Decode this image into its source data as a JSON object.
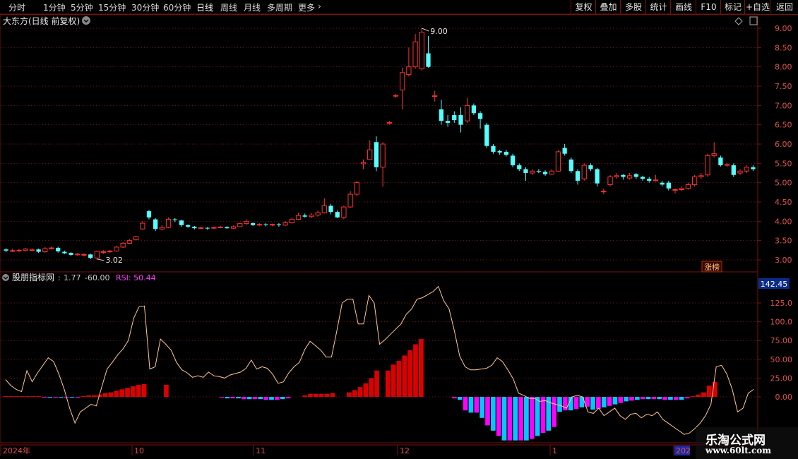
{
  "toolbar": {
    "periods": [
      {
        "label": "分时",
        "active": false
      },
      {
        "label": "1分钟",
        "active": false
      },
      {
        "label": "5分钟",
        "active": false
      },
      {
        "label": "15分钟",
        "active": false
      },
      {
        "label": "30分钟",
        "active": false
      },
      {
        "label": "60分钟",
        "active": false
      },
      {
        "label": "日线",
        "active": true
      },
      {
        "label": "周线",
        "active": false
      },
      {
        "label": "月线",
        "active": false
      },
      {
        "label": "多周期",
        "active": false
      },
      {
        "label": "更多",
        "active": false
      }
    ],
    "tools": [
      "复权",
      "叠加",
      "多股",
      "统计",
      "画线",
      "F10",
      "标记",
      "+自选",
      "返回"
    ]
  },
  "price_pane": {
    "title": "大东方(日线 前复权)",
    "high_label": "9.00",
    "low_label": "3.02",
    "badge": "涨榜",
    "axis_ticks": [
      "9.00",
      "8.50",
      "8.00",
      "7.50",
      "7.00",
      "6.50",
      "6.00",
      "5.50",
      "5.00",
      "4.50",
      "4.00",
      "3.50",
      "3.00"
    ]
  },
  "indicator_pane": {
    "name": "股朋指标网",
    "v1": "1.77",
    "v2": "-60.00",
    "rsi_label": "RSI: 50.44",
    "axis_ticks": [
      "125.0",
      "100.0",
      "75.00",
      "50.00",
      "25.00",
      "0.00"
    ],
    "current_value": "142.45"
  },
  "date_axis": [
    "2024年",
    "10",
    "11",
    "12",
    "1",
    "202"
  ],
  "watermark": {
    "title": "乐淘公式网",
    "url": "www.60lt.com"
  },
  "colors": {
    "up": "#ff3232",
    "down": "#54ffff",
    "bar_red": "#dd0000",
    "bar_cyan": "#00c8ff",
    "bar_magenta": "#ff00ff",
    "rsi_line": "#ffc896",
    "grid": "#7a1010"
  },
  "chart_data": [
    {
      "type": "candlestick",
      "title": "大东方(日线 前复权)",
      "ylim": [
        3.0,
        9.0
      ],
      "y_ticks": [
        9.0,
        8.5,
        8.0,
        7.5,
        7.0,
        6.5,
        6.0,
        5.5,
        5.0,
        4.5,
        4.0,
        3.5,
        3.0
      ],
      "annotations": {
        "high": 9.0,
        "low": 3.02
      },
      "candles": [
        [
          3.27,
          3.24,
          3.3,
          3.2
        ],
        [
          3.24,
          3.24,
          3.29,
          3.2
        ],
        [
          3.24,
          3.25,
          3.28,
          3.21
        ],
        [
          3.25,
          3.28,
          3.31,
          3.22
        ],
        [
          3.26,
          3.26,
          3.3,
          3.22
        ],
        [
          3.27,
          3.21,
          3.29,
          3.18
        ],
        [
          3.21,
          3.29,
          3.33,
          3.18
        ],
        [
          3.29,
          3.31,
          3.35,
          3.27
        ],
        [
          3.31,
          3.22,
          3.34,
          3.19
        ],
        [
          3.21,
          3.17,
          3.24,
          3.15
        ],
        [
          3.18,
          3.13,
          3.2,
          3.1
        ],
        [
          3.13,
          3.15,
          3.18,
          3.11
        ],
        [
          3.14,
          3.14,
          3.17,
          3.09
        ],
        [
          3.14,
          3.05,
          3.16,
          3.02
        ],
        [
          3.05,
          3.22,
          3.24,
          3.02
        ],
        [
          3.2,
          3.21,
          3.25,
          3.16
        ],
        [
          3.21,
          3.23,
          3.26,
          3.18
        ],
        [
          3.23,
          3.33,
          3.36,
          3.21
        ],
        [
          3.33,
          3.43,
          3.46,
          3.31
        ],
        [
          3.43,
          3.5,
          3.54,
          3.41
        ],
        [
          3.52,
          3.6,
          3.63,
          3.5
        ],
        [
          3.8,
          3.95,
          4.0,
          3.78
        ],
        [
          4.26,
          4.1,
          4.3,
          4.05
        ],
        [
          4.05,
          3.8,
          4.08,
          3.75
        ],
        [
          3.8,
          3.84,
          3.9,
          3.76
        ],
        [
          3.84,
          4.05,
          4.1,
          3.82
        ],
        [
          4.05,
          4.03,
          4.08,
          3.98
        ],
        [
          4.02,
          3.9,
          4.04,
          3.86
        ],
        [
          3.9,
          3.86,
          3.92,
          3.83
        ],
        [
          3.86,
          3.82,
          3.88,
          3.79
        ],
        [
          3.82,
          3.83,
          3.86,
          3.8
        ],
        [
          3.83,
          3.82,
          3.85,
          3.78
        ],
        [
          3.82,
          3.84,
          3.86,
          3.8
        ],
        [
          3.84,
          3.85,
          3.88,
          3.82
        ],
        [
          3.85,
          3.82,
          3.87,
          3.8
        ],
        [
          3.82,
          3.86,
          3.89,
          3.8
        ],
        [
          3.86,
          3.94,
          3.96,
          3.85
        ],
        [
          3.94,
          4.0,
          4.05,
          3.9
        ],
        [
          3.95,
          3.9,
          3.97,
          3.88
        ],
        [
          3.9,
          3.92,
          3.95,
          3.88
        ],
        [
          3.92,
          3.9,
          3.95,
          3.87
        ],
        [
          3.9,
          3.92,
          3.94,
          3.87
        ],
        [
          3.92,
          3.9,
          3.95,
          3.86
        ],
        [
          3.9,
          3.96,
          4.0,
          3.88
        ],
        [
          3.96,
          4.05,
          4.1,
          3.94
        ],
        [
          4.05,
          4.15,
          4.22,
          4.03
        ],
        [
          4.15,
          4.12,
          4.2,
          4.1
        ],
        [
          4.12,
          4.16,
          4.22,
          4.08
        ],
        [
          4.16,
          4.22,
          4.28,
          4.12
        ],
        [
          4.22,
          4.4,
          4.6,
          4.2
        ],
        [
          4.4,
          4.24,
          4.45,
          4.18
        ],
        [
          4.24,
          4.1,
          4.28,
          4.08
        ],
        [
          4.1,
          4.37,
          4.4,
          4.05
        ],
        [
          4.37,
          4.7,
          4.78,
          4.35
        ],
        [
          4.7,
          5.0,
          5.05,
          4.65
        ],
        [
          5.49,
          5.52,
          5.6,
          5.35
        ],
        [
          5.6,
          5.85,
          6.1,
          5.75
        ],
        [
          6.05,
          5.4,
          6.2,
          5.3
        ],
        [
          5.4,
          6.0,
          6.05,
          4.9
        ],
        [
          6.54,
          6.56,
          6.6,
          6.5
        ],
        [
          7.24,
          7.26,
          7.3,
          7.2
        ],
        [
          7.4,
          7.85,
          7.98,
          6.9
        ],
        [
          7.8,
          8.0,
          8.5,
          7.75
        ],
        [
          8.0,
          8.65,
          8.85,
          7.95
        ],
        [
          7.95,
          8.9,
          9.0,
          7.9
        ],
        [
          8.35,
          8.0,
          8.8,
          7.98
        ],
        [
          7.25,
          7.25,
          7.38,
          7.1
        ],
        [
          6.9,
          6.6,
          7.15,
          6.5
        ],
        [
          6.6,
          6.55,
          6.75,
          6.45
        ],
        [
          6.75,
          6.62,
          6.85,
          6.55
        ],
        [
          6.75,
          6.5,
          6.95,
          6.3
        ],
        [
          6.6,
          7.0,
          7.2,
          6.55
        ],
        [
          7.0,
          6.8,
          7.05,
          6.75
        ],
        [
          6.8,
          6.65,
          6.85,
          6.4
        ],
        [
          6.5,
          5.95,
          6.55,
          5.9
        ],
        [
          5.95,
          5.8,
          6.0,
          5.75
        ],
        [
          5.82,
          5.78,
          5.85,
          5.72
        ],
        [
          5.8,
          5.72,
          5.85,
          5.68
        ],
        [
          5.7,
          5.45,
          5.75,
          5.4
        ],
        [
          5.45,
          5.35,
          5.5,
          5.3
        ],
        [
          5.35,
          5.25,
          5.4,
          5.05
        ],
        [
          5.25,
          5.3,
          5.35,
          5.2
        ],
        [
          5.3,
          5.28,
          5.35,
          5.25
        ],
        [
          5.28,
          5.22,
          5.32,
          5.18
        ],
        [
          5.22,
          5.3,
          5.35,
          5.2
        ],
        [
          5.3,
          5.8,
          5.85,
          5.28
        ],
        [
          5.9,
          5.75,
          6.0,
          5.7
        ],
        [
          5.6,
          5.3,
          5.65,
          5.25
        ],
        [
          5.3,
          5.05,
          5.35,
          4.95
        ],
        [
          5.1,
          5.45,
          5.5,
          5.05
        ],
        [
          5.45,
          5.35,
          5.5,
          5.3
        ],
        [
          5.35,
          4.98,
          5.38,
          4.9
        ],
        [
          4.78,
          4.78,
          4.85,
          4.7
        ],
        [
          4.95,
          5.15,
          5.2,
          4.9
        ],
        [
          5.15,
          5.18,
          5.25,
          5.1
        ],
        [
          5.2,
          5.15,
          5.22,
          5.08
        ],
        [
          5.12,
          5.18,
          5.25,
          5.08
        ],
        [
          5.22,
          5.15,
          5.25,
          5.1
        ],
        [
          5.15,
          5.1,
          5.18,
          5.05
        ],
        [
          5.1,
          5.05,
          5.15,
          5.0
        ],
        [
          5.05,
          5.07,
          5.2,
          5.03
        ],
        [
          5.0,
          4.95,
          5.05,
          4.9
        ],
        [
          5.0,
          4.85,
          5.05,
          4.8
        ],
        [
          4.8,
          4.82,
          4.85,
          4.72
        ],
        [
          4.82,
          4.85,
          4.9,
          4.78
        ],
        [
          4.85,
          4.95,
          5.0,
          4.82
        ],
        [
          4.95,
          5.15,
          5.2,
          4.9
        ],
        [
          5.15,
          5.18,
          5.25,
          5.1
        ],
        [
          5.2,
          5.7,
          5.75,
          5.15
        ],
        [
          5.7,
          5.75,
          6.05,
          5.65
        ],
        [
          5.65,
          5.45,
          5.7,
          5.42
        ],
        [
          5.45,
          5.47,
          5.5,
          5.4
        ],
        [
          5.45,
          5.2,
          5.5,
          5.15
        ],
        [
          5.25,
          5.3,
          5.35,
          5.2
        ],
        [
          5.3,
          5.4,
          5.45,
          5.25
        ],
        [
          5.4,
          5.35,
          5.45,
          5.3
        ]
      ]
    },
    {
      "type": "bar",
      "title": "股朋指标网",
      "ylim": [
        -60,
        150
      ],
      "y_ticks": [
        125,
        100,
        75,
        50,
        25,
        0
      ],
      "values": [
        1,
        1,
        1,
        1,
        1,
        1,
        1,
        -1,
        -1,
        -1,
        -1,
        -1,
        -1,
        -1,
        1,
        2,
        2,
        3,
        5,
        6,
        8,
        10,
        12,
        14,
        16,
        17,
        0,
        0,
        0,
        16,
        0,
        0,
        0,
        0,
        0,
        0,
        0,
        0,
        0,
        -1,
        -2,
        -2,
        -2,
        -3,
        -3,
        -3,
        -3,
        -4,
        -4,
        -4,
        -3,
        -2,
        0,
        0,
        2,
        4,
        4,
        4,
        4,
        5,
        0,
        0,
        6,
        9,
        13,
        18,
        25,
        35,
        0,
        35,
        43,
        48,
        55,
        62,
        70,
        77,
        0,
        0,
        0,
        0,
        0,
        -2,
        -4,
        -18,
        -21,
        -21,
        -28,
        -38,
        -45,
        -52,
        -58,
        -58,
        -58,
        -58,
        -58,
        -56,
        -52,
        -48,
        -45,
        -40,
        -20,
        -18,
        -18,
        -16,
        -14,
        -13,
        -17,
        -16,
        -14,
        -12,
        -10,
        -8,
        -6,
        -5,
        -4,
        -3,
        -3,
        -3,
        -3,
        -4,
        -4,
        -4,
        -4,
        -2,
        1,
        3,
        6,
        15,
        20,
        0,
        0,
        0,
        0,
        0,
        0,
        0
      ],
      "rsi": [
        23,
        15,
        10,
        7,
        35,
        20,
        32,
        42,
        52,
        47,
        30,
        10,
        -15,
        -35,
        -20,
        -15,
        -10,
        -12,
        13,
        37,
        46,
        56,
        64,
        75,
        105,
        120,
        121,
        37,
        40,
        77,
        70,
        62,
        46,
        36,
        32,
        26,
        28,
        26,
        33,
        28,
        27,
        25,
        29,
        31,
        33,
        38,
        49,
        37,
        40,
        38,
        30,
        18,
        20,
        32,
        40,
        46,
        63,
        74,
        68,
        62,
        53,
        53,
        88,
        125,
        130,
        130,
        97,
        97,
        135,
        125,
        70,
        76,
        83,
        90,
        97,
        110,
        117,
        130,
        132,
        136,
        140,
        147,
        128,
        117,
        88,
        54,
        40,
        36,
        36,
        37,
        38,
        42,
        52,
        47,
        36,
        24,
        5,
        2,
        -2,
        -2,
        -6,
        -5,
        -8,
        -10,
        -12,
        -15,
        0,
        2,
        0,
        -20,
        -22,
        -15,
        -25,
        -20,
        -15,
        -25,
        -30,
        -23,
        -22,
        -28,
        -23,
        -25,
        -20,
        -30,
        -35,
        -40,
        -45,
        -50,
        -48,
        -42,
        -35,
        -25,
        -10,
        40,
        42,
        30,
        10,
        -20,
        -15,
        5,
        10
      ]
    }
  ]
}
